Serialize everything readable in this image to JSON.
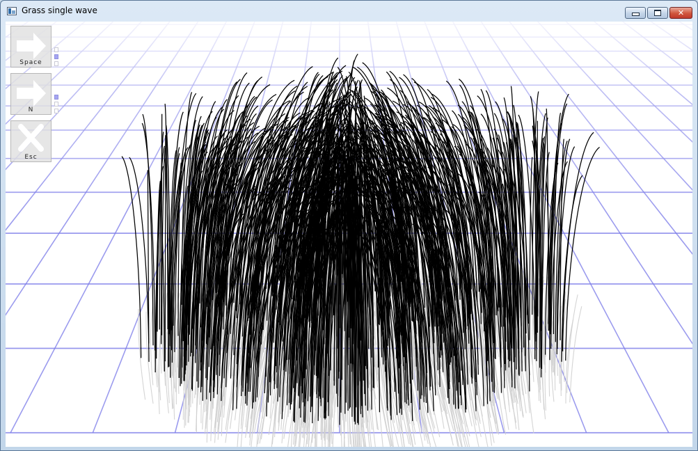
{
  "window": {
    "title": "Grass single wave",
    "icon": "app-window-icon",
    "controls": {
      "minimize": "minimize-icon",
      "maximize": "maximize-icon",
      "close": "close-icon"
    }
  },
  "colors": {
    "grid_line": "#7a7ae8",
    "grass_blade": "#000000",
    "grass_shadow": "#cfcfcf",
    "background": "#ffffff"
  },
  "toolbar": {
    "buttons": [
      {
        "label": "Space",
        "icon": "arrow-right-icon",
        "modes": [
          false,
          true,
          false
        ]
      },
      {
        "label": "N",
        "icon": "arrow-right-icon",
        "modes": [
          true,
          false,
          false
        ]
      },
      {
        "label": "Esc",
        "icon": "x-close-icon",
        "modes": []
      }
    ]
  }
}
